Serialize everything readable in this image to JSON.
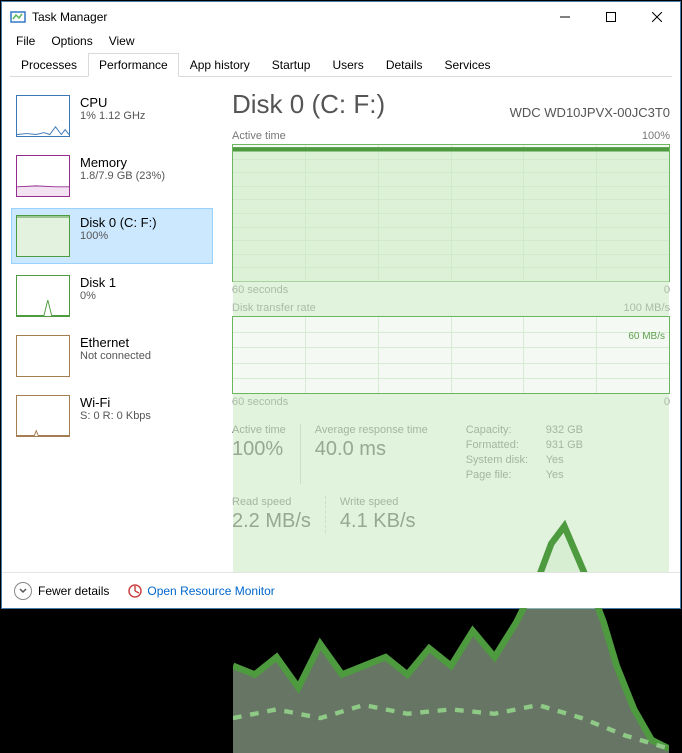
{
  "window": {
    "title": "Task Manager"
  },
  "menubar": [
    "File",
    "Options",
    "View"
  ],
  "tabs": [
    "Processes",
    "Performance",
    "App history",
    "Startup",
    "Users",
    "Details",
    "Services"
  ],
  "active_tab": 1,
  "sidebar": [
    {
      "title": "CPU",
      "sub": "1% 1.12 GHz"
    },
    {
      "title": "Memory",
      "sub": "1.8/7.9 GB (23%)"
    },
    {
      "title": "Disk 0 (C: F:)",
      "sub": "100%"
    },
    {
      "title": "Disk 1",
      "sub": "0%"
    },
    {
      "title": "Ethernet",
      "sub": "Not connected"
    },
    {
      "title": "Wi-Fi",
      "sub": "S: 0 R: 0 Kbps"
    }
  ],
  "main": {
    "title": "Disk 0 (C: F:)",
    "device": "WDC WD10JPVX-00JC3T0",
    "chart1": {
      "label_left": "Active time",
      "label_right": "100%",
      "axis_left": "60 seconds",
      "axis_right": "0"
    },
    "chart2": {
      "label_left": "Disk transfer rate",
      "label_right": "100 MB/s",
      "axis_left": "60 seconds",
      "axis_right": "0",
      "inline_label": "60 MB/s"
    },
    "stats": {
      "active_time_label": "Active time",
      "active_time": "100%",
      "avg_resp_label": "Average response time",
      "avg_resp": "40.0 ms",
      "read_label": "Read speed",
      "read": "2.2 MB/s",
      "write_label": "Write speed",
      "write": "4.1 KB/s"
    },
    "info": [
      {
        "k": "Capacity:",
        "v": "932 GB"
      },
      {
        "k": "Formatted:",
        "v": "931 GB"
      },
      {
        "k": "System disk:",
        "v": "Yes"
      },
      {
        "k": "Page file:",
        "v": "Yes"
      }
    ]
  },
  "footer": {
    "fewer": "Fewer details",
    "resmon": "Open Resource Monitor"
  },
  "chart_data": [
    {
      "type": "area",
      "title": "Active time",
      "ylabel": "%",
      "ylim": [
        0,
        100
      ],
      "xlabel": "seconds",
      "xlim": [
        60,
        0
      ],
      "series": [
        {
          "name": "Active time",
          "values": [
            100,
            100,
            100,
            100,
            100,
            100,
            100,
            100,
            100,
            100,
            100,
            100,
            100,
            100,
            100,
            100,
            100,
            100,
            100,
            100,
            100,
            100,
            100,
            100,
            100,
            100,
            100,
            100,
            100,
            100,
            100,
            100,
            100,
            100,
            100,
            100,
            100,
            100,
            100,
            100,
            100,
            100,
            100,
            100,
            100,
            100,
            100,
            100,
            100,
            100,
            100,
            100,
            100,
            100,
            100,
            100,
            100,
            100,
            100,
            100
          ]
        }
      ]
    },
    {
      "type": "line",
      "title": "Disk transfer rate",
      "ylabel": "MB/s",
      "ylim": [
        0,
        100
      ],
      "xlabel": "seconds",
      "xlim": [
        60,
        0
      ],
      "annotations": [
        "60 MB/s"
      ],
      "series": [
        {
          "name": "Read",
          "values": [
            20,
            18,
            22,
            15,
            25,
            18,
            20,
            16,
            22,
            19,
            24,
            17,
            20,
            15,
            28,
            22,
            18,
            25,
            20,
            16,
            22,
            24,
            18,
            20,
            26,
            19,
            22,
            17,
            20,
            25,
            18,
            22,
            20,
            28,
            16,
            22,
            18,
            30,
            24,
            20,
            26,
            22,
            40,
            35,
            48,
            52,
            38,
            45,
            30,
            25,
            20,
            15,
            10,
            8,
            5,
            3,
            2,
            1,
            1,
            0
          ]
        },
        {
          "name": "Write",
          "values": [
            8,
            10,
            6,
            12,
            8,
            10,
            7,
            11,
            9,
            8,
            10,
            12,
            8,
            9,
            11,
            10,
            8,
            12,
            9,
            10,
            8,
            11,
            9,
            10,
            8,
            12,
            10,
            9,
            11,
            8,
            10,
            9,
            12,
            8,
            10,
            11,
            9,
            10,
            8,
            12,
            10,
            9,
            11,
            10,
            12,
            9,
            8,
            10,
            7,
            6,
            5,
            4,
            3,
            2,
            1,
            1,
            0,
            0,
            0,
            0
          ]
        }
      ]
    }
  ]
}
